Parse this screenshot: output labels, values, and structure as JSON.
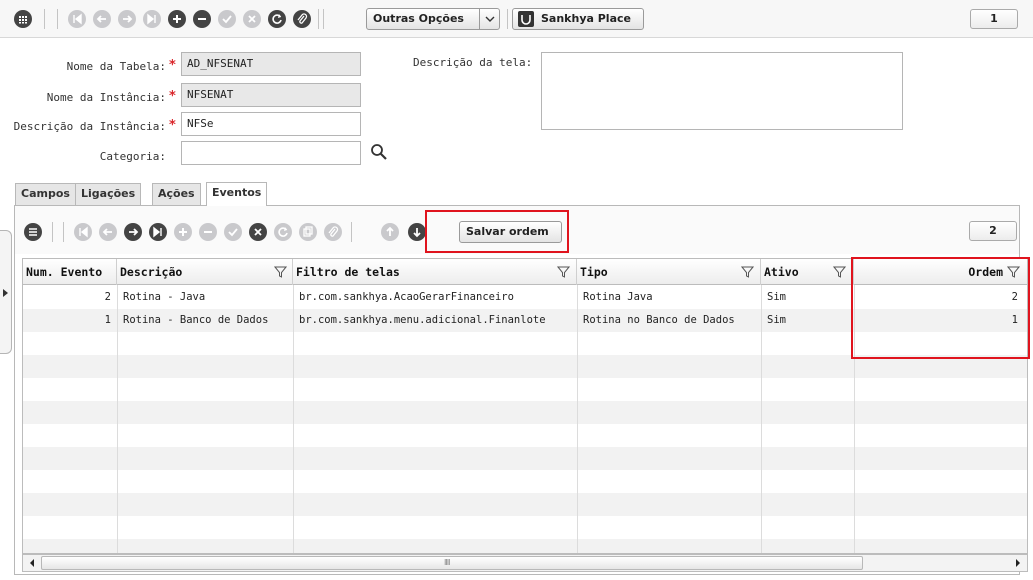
{
  "toolbar": {
    "outras_opcoes_label": "Outras Opções",
    "sankhya_place_label": "Sankhya Place",
    "page_counter": "1"
  },
  "form": {
    "nome_tabela_label": "Nome da Tabela:",
    "nome_tabela_value": "AD_NFSENAT",
    "nome_instancia_label": "Nome da Instância:",
    "nome_instancia_value": "NFSENAT",
    "descricao_instancia_label": "Descrição da Instância:",
    "descricao_instancia_value": "NFSe",
    "categoria_label": "Categoria:",
    "categoria_value": "",
    "descricao_tela_label": "Descrição da tela:",
    "required_mark": "*"
  },
  "tabs": [
    {
      "label": "Campos"
    },
    {
      "label": "Ligações"
    },
    {
      "label": "Ações"
    },
    {
      "label": "Eventos"
    }
  ],
  "events_toolbar": {
    "salvar_ordem_label": "Salvar ordem",
    "page_counter": "2"
  },
  "grid": {
    "columns": [
      "Num. Evento",
      "Descrição",
      "Filtro de telas",
      "Tipo",
      "Ativo",
      "Ordem"
    ],
    "rows": [
      {
        "num": "2",
        "descricao": "Rotina - Java",
        "filtro": "br.com.sankhya.AcaoGerarFinanceiro",
        "tipo": "Rotina Java",
        "ativo": "Sim",
        "ordem": "2"
      },
      {
        "num": "1",
        "descricao": "Rotina - Banco de Dados",
        "filtro": "br.com.sankhya.menu.adicional.Finanlote",
        "tipo": "Rotina no Banco de Dados",
        "ativo": "Sim",
        "ordem": "1"
      }
    ],
    "scroll_grip": "IIII"
  },
  "colors": {
    "highlight": "#e0141e",
    "required": "#d9262b",
    "icon_dark": "#444444",
    "icon_disabled": "#c9c9cc"
  }
}
